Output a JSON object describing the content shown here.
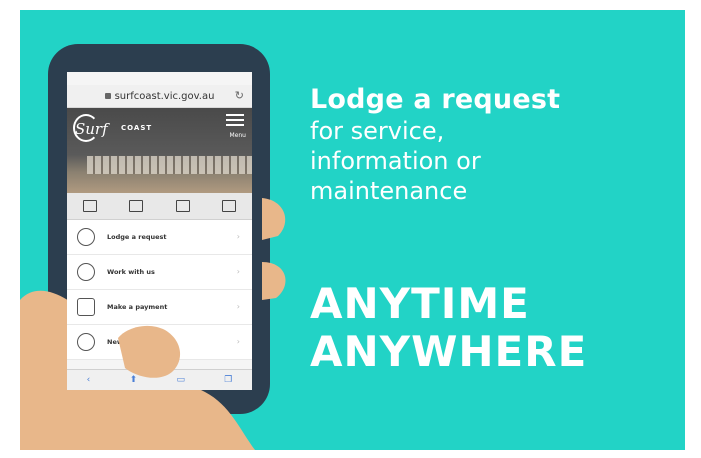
{
  "headline": {
    "strong": "Lodge a request",
    "lines": [
      "for service,",
      "information or",
      "maintenance"
    ]
  },
  "slogan": {
    "line1": "ANYTIME",
    "line2": "ANYWHERE"
  },
  "phone": {
    "url": "surfcoast.vic.gov.au",
    "site_logo": "Surf",
    "site_logo_word": "COAST",
    "menu_label": "Menu",
    "list_items": [
      {
        "label": "Lodge a request",
        "icon": "person-question-icon"
      },
      {
        "label": "Work with us",
        "icon": "people-icon"
      },
      {
        "label": "Make a payment",
        "icon": "wallet-icon"
      },
      {
        "label": "New...",
        "icon": "person-badge-icon"
      }
    ]
  },
  "colors": {
    "panel": "#22d3c6",
    "phone_frame": "#2c3e4f",
    "skin": "#e8b78a",
    "text": "#ffffff"
  }
}
